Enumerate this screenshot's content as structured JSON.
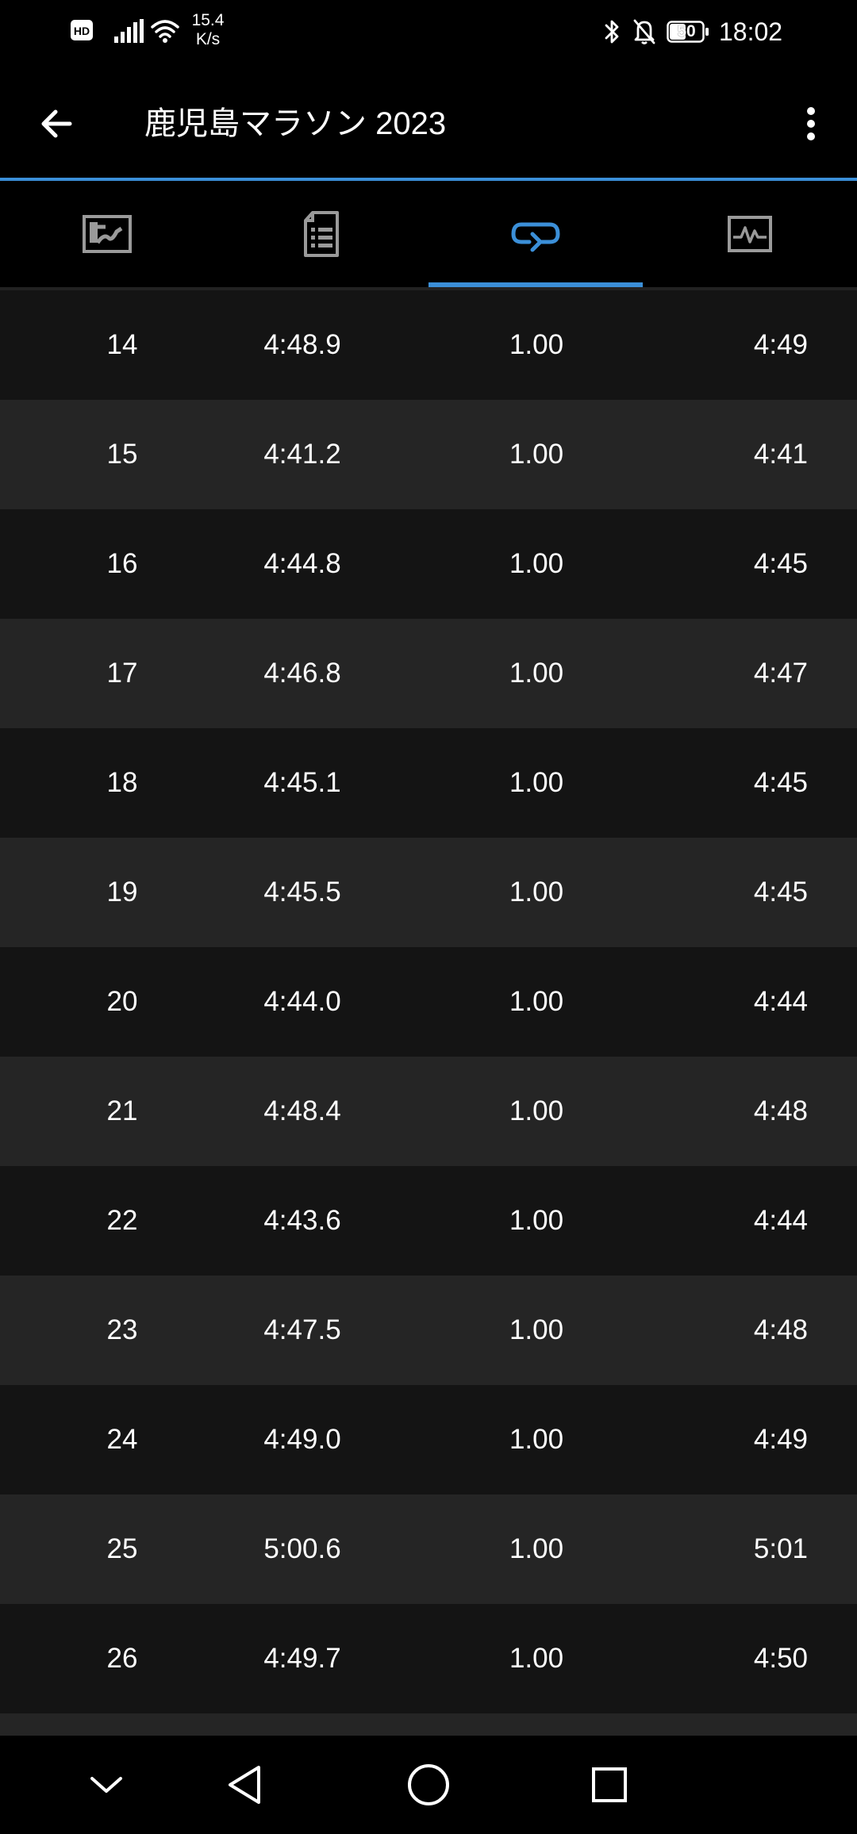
{
  "status_bar": {
    "hd_label": "HD",
    "net_speed_value": "15.4",
    "net_speed_unit": "K/s",
    "battery": "50",
    "time": "18:02",
    "icons": [
      "hd-icon",
      "signal-icon",
      "wifi-icon",
      "bluetooth-icon",
      "bell-off-icon",
      "battery-icon"
    ]
  },
  "app_bar": {
    "title": "鹿児島マラソン 2023",
    "back_icon": "arrow-left-icon",
    "menu_icon": "more-vert-icon"
  },
  "colors": {
    "accent": "#3b8fd8",
    "row_dark": "#141414",
    "row_light": "#252525",
    "background": "#000000",
    "text": "#ffffff"
  },
  "tabs": [
    {
      "icon": "map-icon",
      "selected": false
    },
    {
      "icon": "document-list-icon",
      "selected": false
    },
    {
      "icon": "laps-icon",
      "selected": true
    },
    {
      "icon": "chart-icon",
      "selected": false
    }
  ],
  "laps": [
    {
      "lap": "14",
      "time": "4:48.9",
      "distance": "1.00",
      "pace": "4:49"
    },
    {
      "lap": "15",
      "time": "4:41.2",
      "distance": "1.00",
      "pace": "4:41"
    },
    {
      "lap": "16",
      "time": "4:44.8",
      "distance": "1.00",
      "pace": "4:45"
    },
    {
      "lap": "17",
      "time": "4:46.8",
      "distance": "1.00",
      "pace": "4:47"
    },
    {
      "lap": "18",
      "time": "4:45.1",
      "distance": "1.00",
      "pace": "4:45"
    },
    {
      "lap": "19",
      "time": "4:45.5",
      "distance": "1.00",
      "pace": "4:45"
    },
    {
      "lap": "20",
      "time": "4:44.0",
      "distance": "1.00",
      "pace": "4:44"
    },
    {
      "lap": "21",
      "time": "4:48.4",
      "distance": "1.00",
      "pace": "4:48"
    },
    {
      "lap": "22",
      "time": "4:43.6",
      "distance": "1.00",
      "pace": "4:44"
    },
    {
      "lap": "23",
      "time": "4:47.5",
      "distance": "1.00",
      "pace": "4:48"
    },
    {
      "lap": "24",
      "time": "4:49.0",
      "distance": "1.00",
      "pace": "4:49"
    },
    {
      "lap": "25",
      "time": "5:00.6",
      "distance": "1.00",
      "pace": "5:01"
    },
    {
      "lap": "26",
      "time": "4:49.7",
      "distance": "1.00",
      "pace": "4:50"
    }
  ],
  "nav_bar": {
    "icons": [
      "chevron-down-icon",
      "nav-back-icon",
      "nav-home-icon",
      "nav-recents-icon"
    ]
  }
}
